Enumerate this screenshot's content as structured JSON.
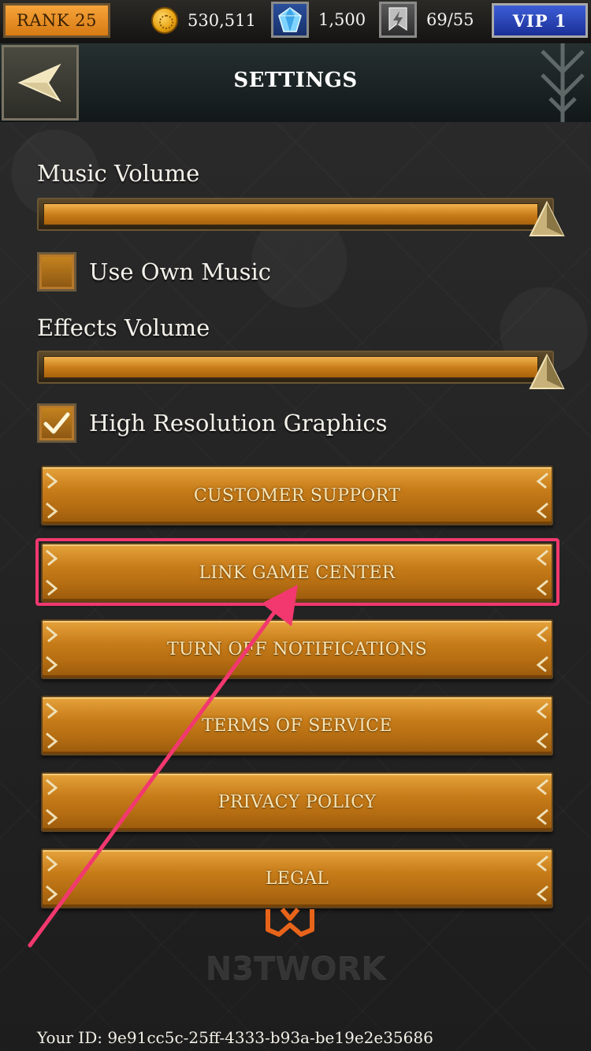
{
  "topbar": {
    "rank": "RANK 25",
    "gold": "530,511",
    "gems": "1,500",
    "energy": "69/55",
    "vip": "VIP 1"
  },
  "header": {
    "title": "SETTINGS"
  },
  "settings": {
    "music_volume": {
      "label": "Music Volume",
      "level": 1.0
    },
    "use_own_music": {
      "label": "Use Own Music",
      "checked": false
    },
    "effects_volume": {
      "label": "Effects Volume",
      "level": 1.0
    },
    "high_res": {
      "label": "High Resolution Graphics",
      "checked": true
    }
  },
  "buttons": [
    {
      "label": "CUSTOMER SUPPORT"
    },
    {
      "label": "LINK GAME CENTER"
    },
    {
      "label": "TURN OFF NOTIFICATIONS"
    },
    {
      "label": "TERMS OF SERVICE"
    },
    {
      "label": "PRIVACY POLICY"
    },
    {
      "label": "LEGAL"
    }
  ],
  "footer": {
    "brand": "N3TWORK",
    "user_id": "Your ID: 9e91cc5c-25ff-4333-b93a-be19e2e35686"
  },
  "colors": {
    "accent_gold": "#c77c19",
    "annotation_pink": "#f2386f",
    "vip_blue": "#2a44b8",
    "rank_orange": "#e98b20"
  },
  "icons": [
    "coin-icon",
    "gem-icon",
    "energy-icon",
    "back-arrow-icon",
    "checkmark-icon",
    "slider-thumb-icon",
    "brand-logo-icon"
  ]
}
